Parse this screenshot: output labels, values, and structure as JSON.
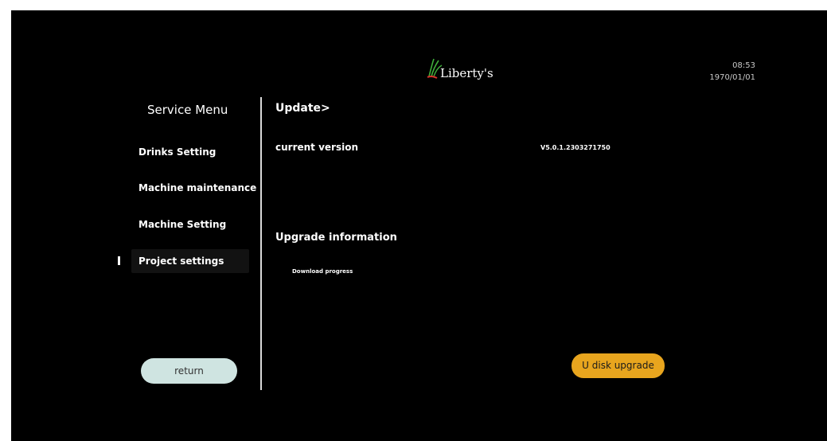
{
  "header": {
    "brand": "Liberty's",
    "time": "08:53",
    "date": "1970/01/01"
  },
  "sidebar": {
    "title": "Service Menu",
    "items": [
      {
        "label": "Drinks Setting"
      },
      {
        "label": "Machine maintenance"
      },
      {
        "label": "Machine Setting"
      },
      {
        "label": "Project settings",
        "active": true
      }
    ],
    "return_label": "return"
  },
  "main": {
    "breadcrumb": "Update>",
    "current_version_label": "current version",
    "current_version_value": "V5.0.1.2303271750",
    "upgrade_info_title": "Upgrade information",
    "download_progress_label": "Download progress",
    "udisk_button_label": "U disk upgrade"
  },
  "colors": {
    "background": "#000000",
    "return_button": "#cfe4e1",
    "upgrade_button": "#e8a51e",
    "logo_green": "#3fae3a",
    "logo_red": "#d9322b"
  },
  "icons": {
    "logo": "leaf-logo-icon"
  }
}
